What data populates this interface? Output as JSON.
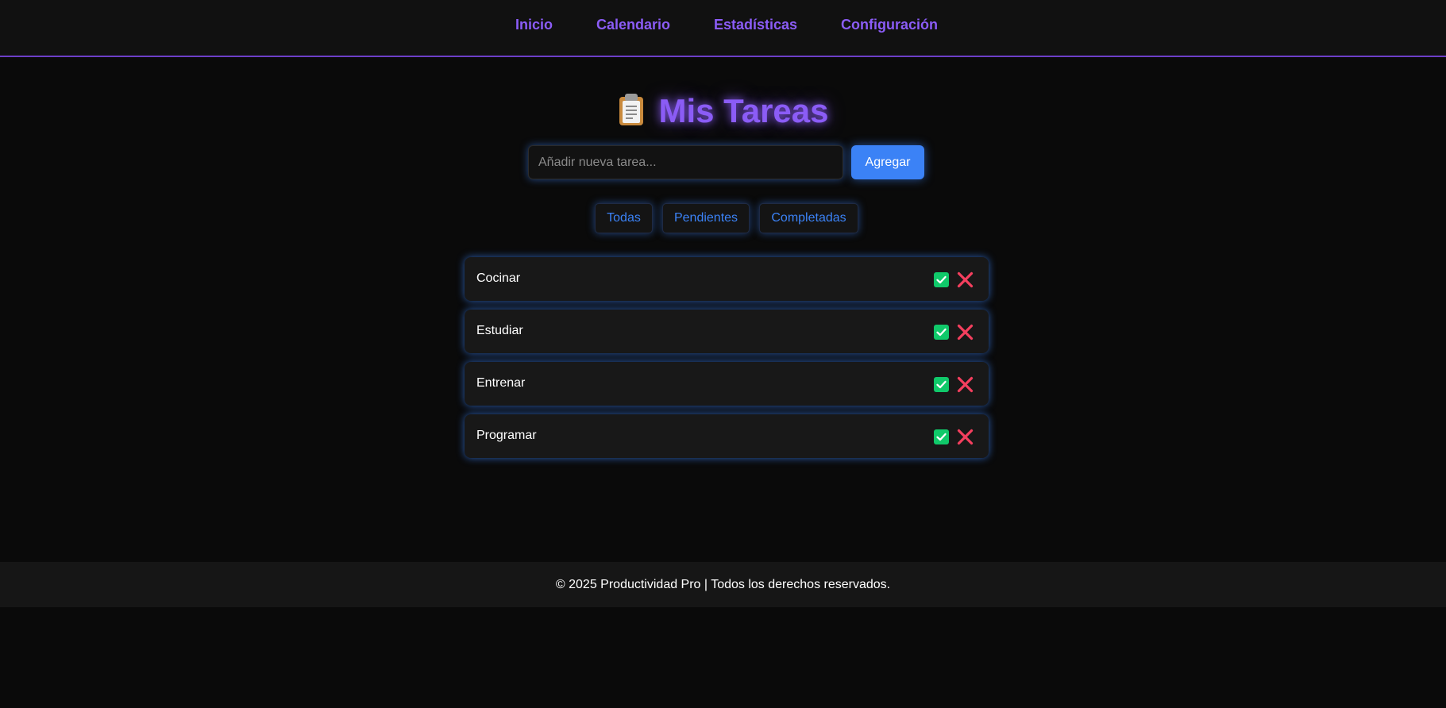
{
  "nav": {
    "items": [
      {
        "label": "Inicio"
      },
      {
        "label": "Calendario"
      },
      {
        "label": "Estadísticas"
      },
      {
        "label": "Configuración"
      }
    ]
  },
  "header": {
    "icon": "clipboard-icon",
    "title": "Mis Tareas"
  },
  "new_task": {
    "placeholder": "Añadir nueva tarea...",
    "value": "",
    "button_label": "Agregar"
  },
  "filters": [
    {
      "label": "Todas"
    },
    {
      "label": "Pendientes"
    },
    {
      "label": "Completadas"
    }
  ],
  "tasks": [
    {
      "label": "Cocinar",
      "complete_icon": "check-icon",
      "delete_icon": "close-icon"
    },
    {
      "label": "Estudiar",
      "complete_icon": "check-icon",
      "delete_icon": "close-icon"
    },
    {
      "label": "Entrenar",
      "complete_icon": "check-icon",
      "delete_icon": "close-icon"
    },
    {
      "label": "Programar",
      "complete_icon": "check-icon",
      "delete_icon": "close-icon"
    }
  ],
  "footer": {
    "text": "© 2025 Productividad Pro | Todos los derechos reservados."
  },
  "colors": {
    "background": "#0a0a0a",
    "nav_background": "#111111",
    "accent_purple": "#8b5cf6",
    "accent_blue": "#3b82f6",
    "complete_green": "#10c96a",
    "delete_red": "#f43f5e",
    "card_background": "#181818",
    "footer_background": "#161616"
  }
}
